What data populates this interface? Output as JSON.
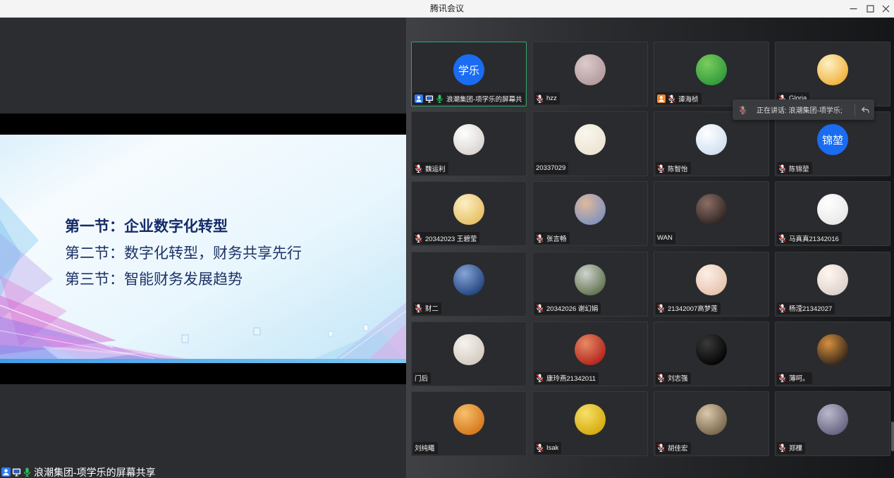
{
  "window": {
    "title": "腾讯会议",
    "controls": [
      "minimize-icon",
      "maximize-icon",
      "close-icon"
    ]
  },
  "colors": {
    "speaking_border": "#34a56c",
    "host_badge": "#2f7bf5",
    "cohost_badge": "#f0862a",
    "mic_on": "#2fc161",
    "mic_muted": "#f0f0f0",
    "mic_muted_slash": "#e5322d",
    "toast_mic": "#9a9a9a"
  },
  "share": {
    "slide": {
      "lines": [
        "第一节：企业数字化转型",
        "第二节：数字化转型，财务共享先行",
        "第三节：智能财务发展趋势"
      ]
    },
    "caption_icons": [
      "host-icon",
      "screen-share-icon",
      "mic-on-icon"
    ],
    "caption": "浪潮集团-项学乐的屏幕共享"
  },
  "toast": {
    "icon": "toast-mic-icon",
    "text": "正在讲话: 浪潮集团-项学乐;",
    "action_icon": "collapse-icon"
  },
  "participants": [
    {
      "name": "浪潮集团-项学乐的屏幕共...",
      "avatar_text": "学乐",
      "avatar_colors": [
        "#1a6cf2",
        "#1a6cf2"
      ],
      "icons": [
        "host-icon",
        "screen-share-icon",
        "mic-on-icon"
      ],
      "speaking": true
    },
    {
      "name": "hzz",
      "avatar_colors": [
        "#b39a9e",
        "#dccacb"
      ],
      "icons": [
        "mic-muted-icon"
      ]
    },
    {
      "name": "谭海桢",
      "avatar_colors": [
        "#2f9a3a",
        "#7ccc5e"
      ],
      "icons": [
        "cohost-icon",
        "mic-muted-icon"
      ]
    },
    {
      "name": "Gloria",
      "avatar_colors": [
        "#f1b23c",
        "#fdf0c4"
      ],
      "icons": [
        "mic-muted-icon"
      ]
    },
    {
      "name": "魏运利",
      "avatar_colors": [
        "#d9d3d0",
        "#ffffff"
      ],
      "icons": [
        "mic-muted-icon"
      ]
    },
    {
      "name": "20337029",
      "avatar_colors": [
        "#ece3d2",
        "#faf6ee"
      ],
      "icons": []
    },
    {
      "name": "陈智怡",
      "avatar_colors": [
        "#cfdff0",
        "#ffffff"
      ],
      "icons": [
        "mic-muted-icon"
      ]
    },
    {
      "name": "陈锦堃",
      "avatar_text": "锦堃",
      "avatar_colors": [
        "#1a6cf2",
        "#1a6cf2"
      ],
      "icons": [
        "mic-muted-icon"
      ]
    },
    {
      "name": "20342023 王碧莹",
      "avatar_colors": [
        "#e6bf62",
        "#fcefc6"
      ],
      "icons": [
        "mic-muted-icon"
      ]
    },
    {
      "name": "张言畅",
      "avatar_colors": [
        "#7f93bd",
        "#e0b89c"
      ],
      "icons": [
        "mic-muted-icon"
      ]
    },
    {
      "name": "WAN",
      "avatar_colors": [
        "#2e2422",
        "#8c6f66"
      ],
      "icons": []
    },
    {
      "name": "马真真21342016",
      "avatar_colors": [
        "#e8e8e8",
        "#ffffff"
      ],
      "icons": [
        "mic-muted-icon"
      ]
    },
    {
      "name": "财二",
      "avatar_colors": [
        "#23447e",
        "#86a4d6"
      ],
      "icons": [
        "mic-muted-icon"
      ]
    },
    {
      "name": "20342026 谢幻娟",
      "avatar_colors": [
        "#62734e",
        "#cfd3cf"
      ],
      "icons": [
        "mic-muted-icon"
      ]
    },
    {
      "name": "21342007高梦莲",
      "avatar_colors": [
        "#e6c2ad",
        "#fcf0e8"
      ],
      "icons": [
        "mic-muted-icon"
      ]
    },
    {
      "name": "杨滢21342027",
      "avatar_colors": [
        "#ddd2cb",
        "#fff7f0"
      ],
      "icons": [
        "mic-muted-icon"
      ]
    },
    {
      "name": "门后",
      "avatar_colors": [
        "#d2cbc0",
        "#f6f3ee"
      ],
      "icons": []
    },
    {
      "name": "康玲燕21342011",
      "avatar_colors": [
        "#b3241c",
        "#e58a64"
      ],
      "icons": [
        "mic-muted-icon"
      ]
    },
    {
      "name": "刘志强",
      "avatar_colors": [
        "#030303",
        "#3a3a3a"
      ],
      "icons": [
        "mic-muted-icon"
      ]
    },
    {
      "name": "薄呵。",
      "avatar_colors": [
        "#34251a",
        "#d6903e"
      ],
      "icons": [
        "mic-muted-icon"
      ]
    },
    {
      "name": "刘纯曦",
      "avatar_colors": [
        "#d5761c",
        "#f6c06a"
      ],
      "icons": []
    },
    {
      "name": "Isak",
      "avatar_colors": [
        "#d5aa0c",
        "#f6e06a"
      ],
      "icons": [
        "mic-muted-icon"
      ]
    },
    {
      "name": "胡佳宏",
      "avatar_colors": [
        "#76664c",
        "#dcc8ac"
      ],
      "icons": [
        "mic-muted-icon"
      ]
    },
    {
      "name": "郑棵",
      "avatar_colors": [
        "#646480",
        "#bcb8cc"
      ],
      "icons": [
        "mic-muted-icon"
      ]
    }
  ]
}
